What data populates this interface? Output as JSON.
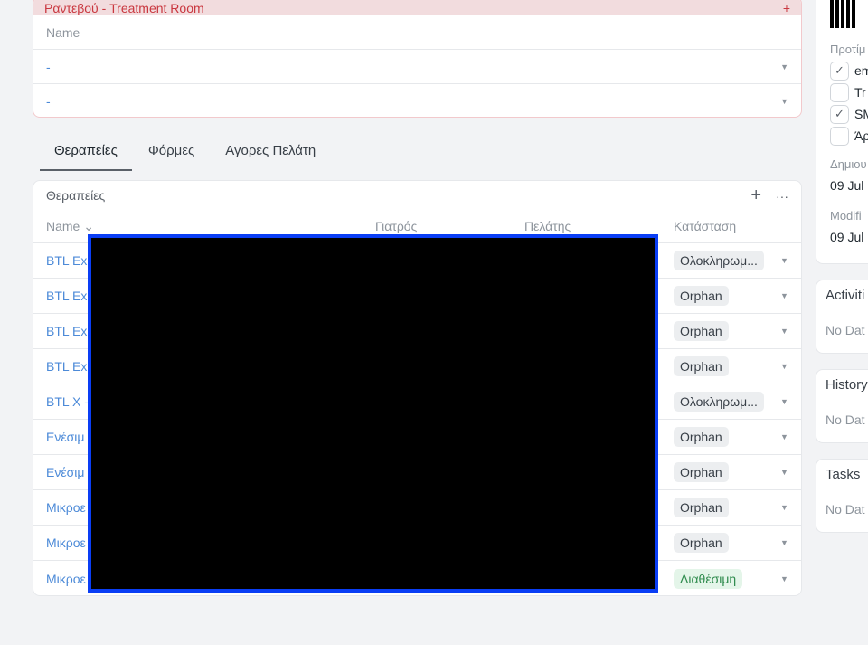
{
  "top_section": {
    "title": "Ραντεβού - Treatment Room",
    "column": "Name",
    "rows": [
      "-",
      "-"
    ]
  },
  "tabs": [
    "Θεραπείες",
    "Φόρμες",
    "Αγορες Πελάτη"
  ],
  "therapies": {
    "title": "Θεραπείες",
    "add": "+",
    "more": "···",
    "columns": [
      "Name ⌄",
      "Γιατρός",
      "Πελάτης",
      "Κατάσταση"
    ],
    "rows": [
      {
        "name": "BTL Ex",
        "status": "Ολοκληρωμ..."
      },
      {
        "name": "BTL Ex",
        "status": "Orphan"
      },
      {
        "name": "BTL Ex",
        "status": "Orphan"
      },
      {
        "name": "BTL Ex",
        "status": "Orphan"
      },
      {
        "name": "BTL X -",
        "status": "Ολοκληρωμ..."
      },
      {
        "name": "Ενέσιμ",
        "status": "Orphan"
      },
      {
        "name": "Ενέσιμ",
        "status": "Orphan"
      },
      {
        "name": "Μικροε",
        "status": "Orphan"
      },
      {
        "name": "Μικροε",
        "status": "Orphan"
      },
      {
        "name": "Μικροε",
        "status": "Διαθέσιμη"
      }
    ]
  },
  "sidebar": {
    "pref_label": "Προτίμ",
    "prefs": [
      {
        "label": "em",
        "checked": true
      },
      {
        "label": "Tr",
        "checked": false
      },
      {
        "label": "SM",
        "checked": true
      },
      {
        "label": "Άρ",
        "checked": false
      }
    ],
    "created_label": "Δημιου",
    "created": "09 Jul",
    "modified_label": "Modifi",
    "modified": "09 Jul",
    "cards": [
      {
        "title": "Activiti",
        "empty": "No Dat"
      },
      {
        "title": "History",
        "empty": "No Dat"
      },
      {
        "title": "Tasks",
        "empty": "No Dat"
      }
    ]
  }
}
